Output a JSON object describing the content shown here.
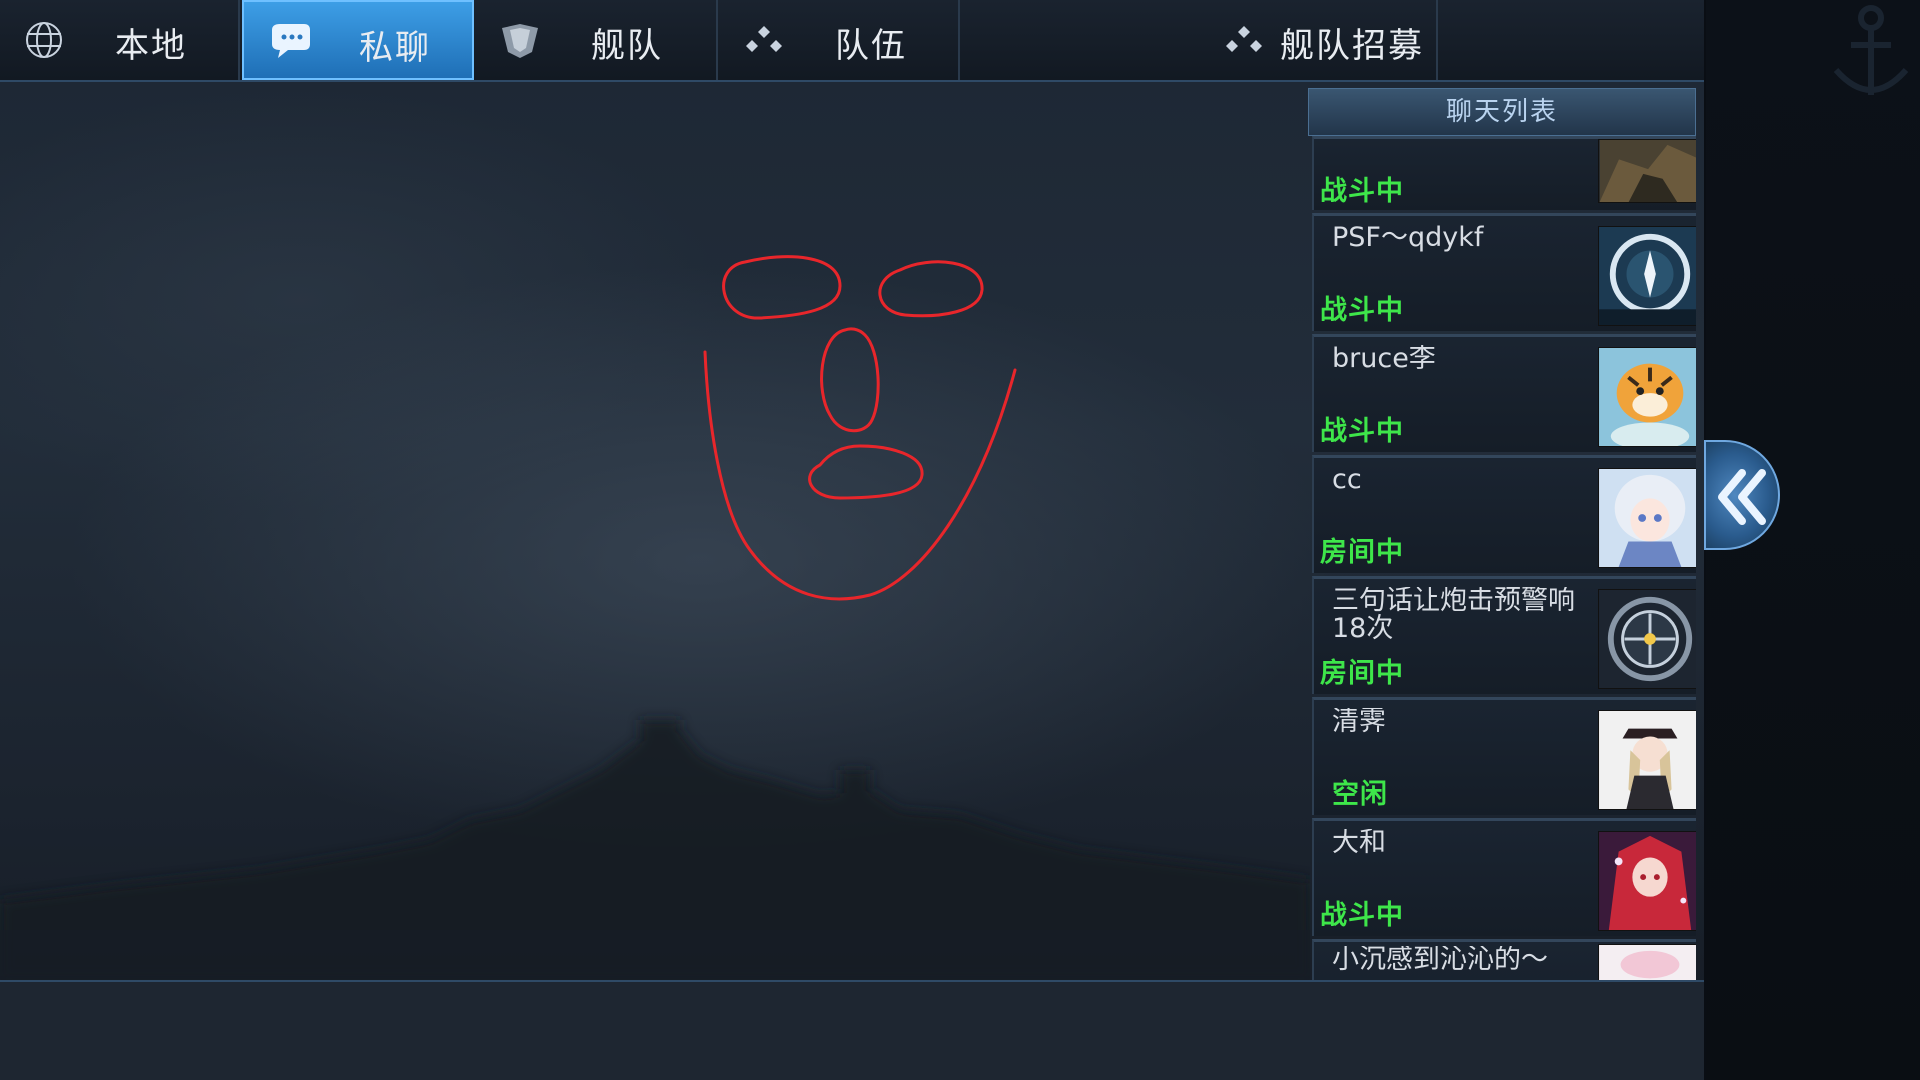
{
  "tabs": [
    {
      "id": "local",
      "label": "本地",
      "icon": "globe-icon",
      "active": false
    },
    {
      "id": "private",
      "label": "私聊",
      "icon": "chat-bubble-icon",
      "active": true
    },
    {
      "id": "fleet",
      "label": "舰队",
      "icon": "fleet-badge-icon",
      "active": false
    },
    {
      "id": "team",
      "label": "队伍",
      "icon": "team-dots-icon",
      "active": false
    },
    {
      "id": "recruit",
      "label": "舰队招募",
      "icon": "recruit-dots-icon",
      "active": false
    }
  ],
  "chat_list": {
    "title": "聊天列表",
    "items": [
      {
        "name": "",
        "status": "战斗中",
        "avatar": "soldier-avatar"
      },
      {
        "name": "PSF～qdykf",
        "status": "战斗中",
        "avatar": "emblem-avatar"
      },
      {
        "name": "bruce李",
        "status": "战斗中",
        "avatar": "tiger-avatar"
      },
      {
        "name": "cc",
        "status": "房间中",
        "avatar": "anime-girl-silver-avatar"
      },
      {
        "name": "三句话让炮击预警响18次",
        "status": "房间中",
        "avatar": "gear-emblem-avatar"
      },
      {
        "name": "清霁",
        "status": "空闲",
        "avatar": "officer-girl-avatar"
      },
      {
        "name": "大和",
        "status": "战斗中",
        "avatar": "red-hair-girl-avatar"
      },
      {
        "name": "小沉感到沁沁的～",
        "status": "",
        "avatar": "pink-avatar"
      }
    ]
  },
  "colors": {
    "active_tab": "#2f86d0",
    "status_green": "#3ee64a",
    "face_stroke": "#e8262b"
  },
  "collapse_button": {
    "icon": "double-chevron-left-icon"
  }
}
